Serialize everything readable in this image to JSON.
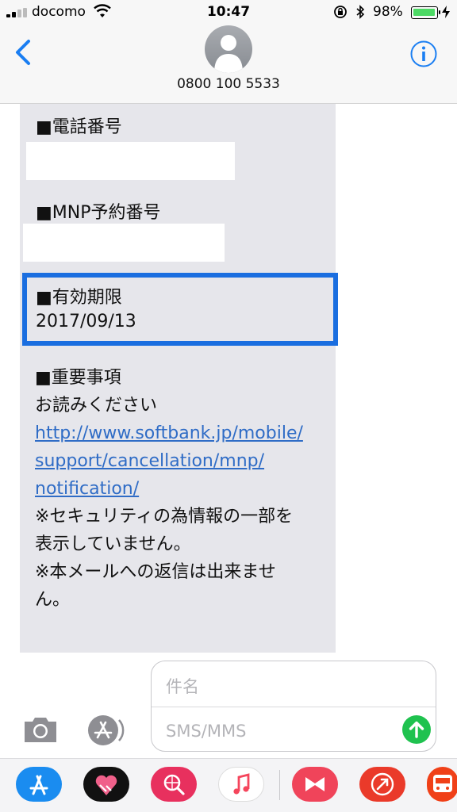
{
  "status_bar": {
    "carrier": "docomo",
    "time": "10:47",
    "battery_percent": "98%",
    "battery_level": 0.98,
    "icons": [
      "signal-icon",
      "wifi-icon",
      "rotation-lock-icon",
      "bluetooth-icon",
      "battery-icon",
      "charging-icon"
    ]
  },
  "header": {
    "contact": "0800 100 5533",
    "icons": [
      "back-icon",
      "avatar-icon",
      "info-icon"
    ]
  },
  "message": {
    "phone_label": "■電話番号",
    "mnp_label": "■MNP予約番号",
    "expiry_label": "■有効期限",
    "expiry_value": "2017/09/13",
    "important_label": "■重要事項",
    "read_text": "お読みください",
    "link_lines": [
      "http://www.softbank.jp/mobile/",
      "support/cancellation/mnp/",
      "notification/"
    ],
    "note_lines": [
      "※セキュリティの為情報の一部を",
      "表示していません。",
      "※本メールへの返信は出来ませ",
      "ん。"
    ]
  },
  "compose": {
    "subject_placeholder": "件名",
    "body_placeholder": "SMS/MMS"
  },
  "drawer": {
    "apps": [
      {
        "icon": "app-store-icon",
        "color": "#1a8cf0"
      },
      {
        "icon": "heart-hands-icon",
        "color": "#111111"
      },
      {
        "icon": "web-search-icon",
        "color": "#e8305e"
      },
      {
        "icon": "music-icon",
        "color": "#ffffff"
      },
      {
        "icon": "bowtie-icon",
        "color": "#f0445a"
      },
      {
        "icon": "compass-arrow-icon",
        "color": "#ea3a2a"
      },
      {
        "icon": "train-icon",
        "color": "#f04018"
      }
    ]
  },
  "colors": {
    "accent": "#1a6ee0",
    "link": "#2f6cc6",
    "bubble": "#e6e6eb",
    "send": "#1fc24f"
  }
}
